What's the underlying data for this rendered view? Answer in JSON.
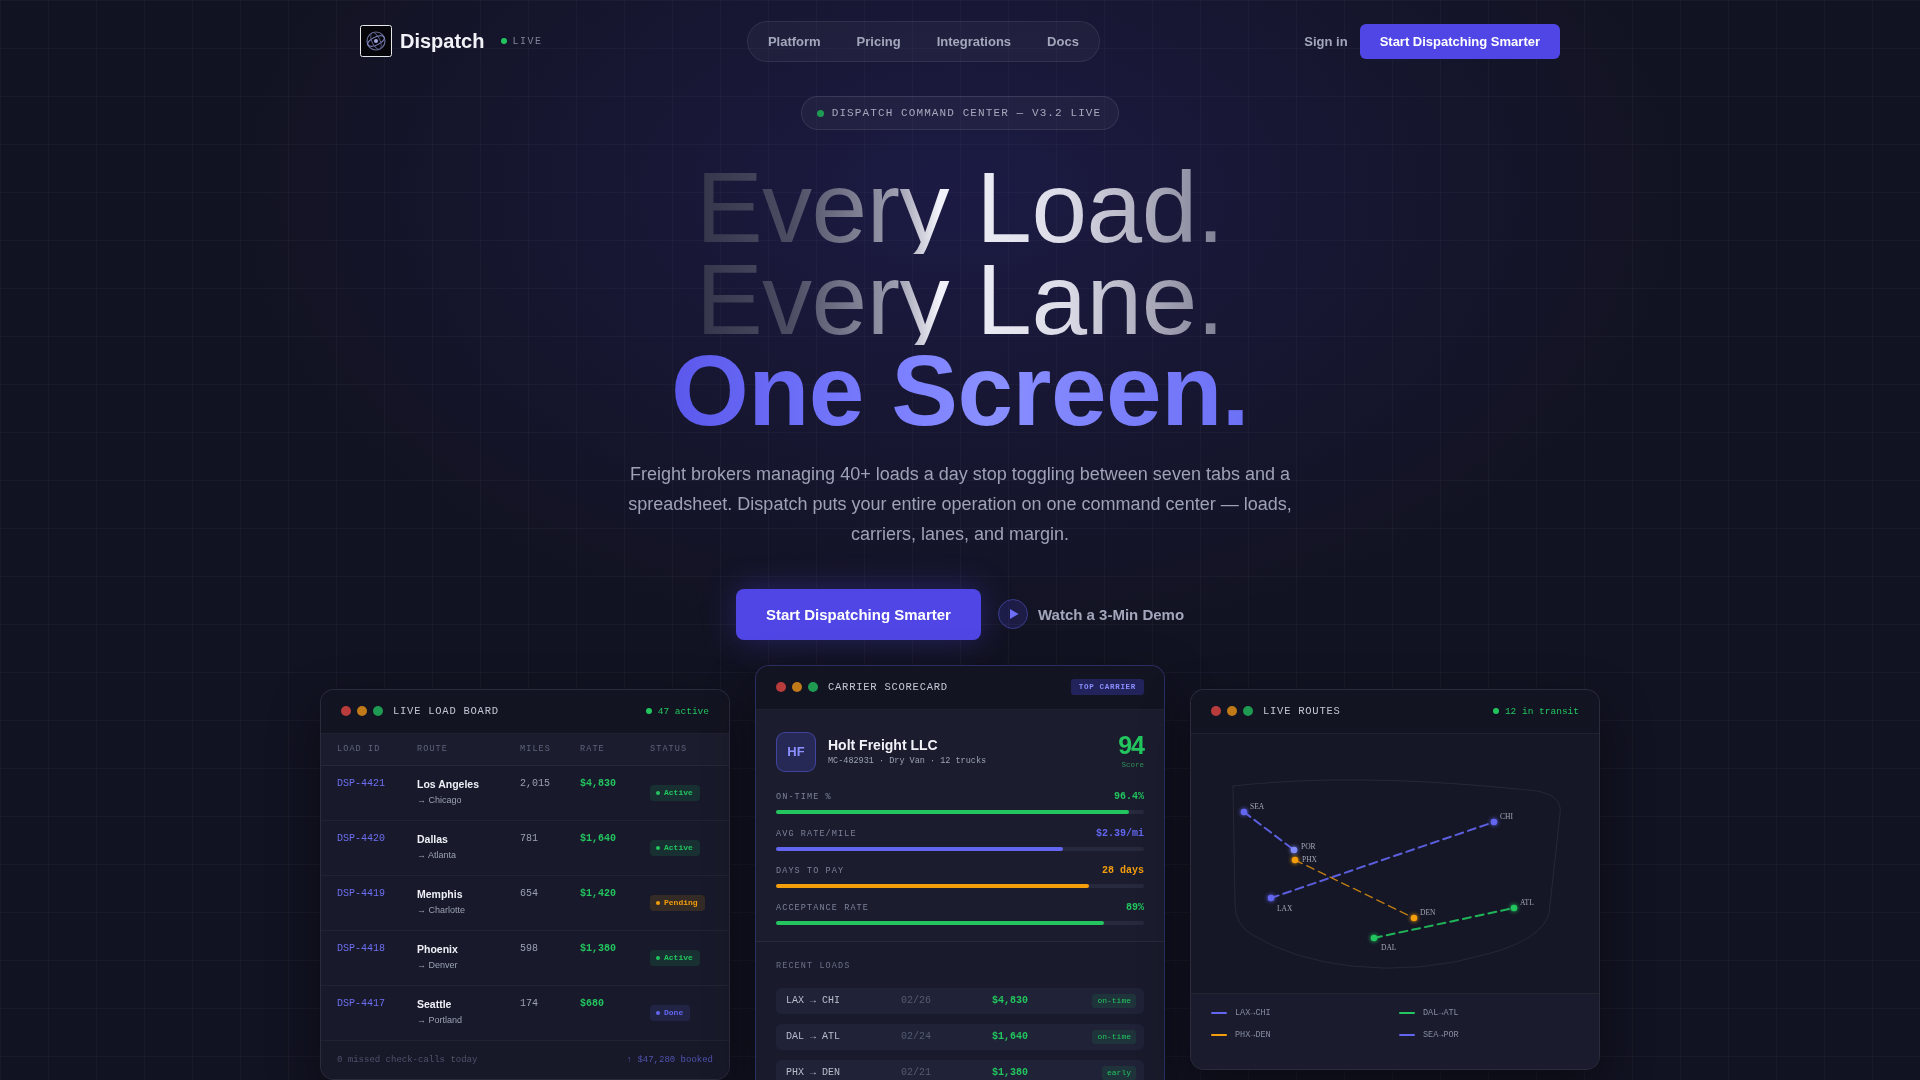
{
  "nav": {
    "brand": "Dispatch",
    "live_label": "LIVE",
    "links": [
      "Platform",
      "Pricing",
      "Integrations",
      "Docs"
    ],
    "sign_in": "Sign in",
    "cta": "Start Dispatching Smarter"
  },
  "hero": {
    "badge": "DISPATCH COMMAND CENTER — V3.2 LIVE",
    "headline": [
      {
        "text": "Every Load.",
        "kind": "muted"
      },
      {
        "text": "Every Lane.",
        "kind": "muted"
      },
      {
        "text": "One Screen.",
        "kind": "accent"
      }
    ],
    "subtitle": "Freight brokers managing 40+ loads a day stop toggling between seven tabs and a spreadsheet. Dispatch puts your entire operation on one command center — loads, carriers, lanes, and margin.",
    "primary_cta": "Start Dispatching Smarter",
    "demo": "Watch a 3-Min Demo"
  },
  "load_board": {
    "title": "LIVE LOAD BOARD",
    "status": "47 active",
    "columns": [
      "LOAD ID",
      "ROUTE",
      "MILES",
      "RATE",
      "STATUS"
    ],
    "rows": [
      {
        "id": "DSP-4421",
        "origin": "Los Angeles",
        "destination": "→ Chicago",
        "miles": "2,015",
        "rate": "$4,830",
        "status": "Active",
        "color": "#22c55e"
      },
      {
        "id": "DSP-4420",
        "origin": "Dallas",
        "destination": "→ Atlanta",
        "miles": "781",
        "rate": "$1,640",
        "status": "Active",
        "color": "#22c55e"
      },
      {
        "id": "DSP-4419",
        "origin": "Memphis",
        "destination": "→ Charlotte",
        "miles": "654",
        "rate": "$1,420",
        "status": "Pending",
        "color": "#f59e0b"
      },
      {
        "id": "DSP-4418",
        "origin": "Phoenix",
        "destination": "→ Denver",
        "miles": "598",
        "rate": "$1,380",
        "status": "Active",
        "color": "#22c55e"
      },
      {
        "id": "DSP-4417",
        "origin": "Seattle",
        "destination": "→ Portland",
        "miles": "174",
        "rate": "$680",
        "status": "Done",
        "color": "#6366f1"
      }
    ],
    "footer_note": "0 missed check-calls today",
    "footer_total": "↑ $47,280 booked"
  },
  "carrier": {
    "title": "CARRIER SCORECARD",
    "tag": "TOP CARRIER",
    "initials": "HF",
    "name": "Holt Freight LLC",
    "meta": "MC-482931 · Dry Van · 12 trucks",
    "score": "94",
    "score_label": "Score",
    "metrics": [
      {
        "label": "ON-TIME %",
        "value": "96.4%",
        "level": 0.96,
        "color": "#22c55e"
      },
      {
        "label": "AVG RATE/MILE",
        "value": "$2.39/mi",
        "level": 0.78,
        "color": "#6366f1"
      },
      {
        "label": "DAYS TO PAY",
        "value": "28 days",
        "level": 0.85,
        "color": "#f59e0b"
      },
      {
        "label": "ACCEPTANCE RATE",
        "value": "89%",
        "level": 0.89,
        "color": "#22c55e"
      }
    ],
    "recent_title": "RECENT LOADS",
    "recent": [
      {
        "route": "LAX → CHI",
        "date": "02/26",
        "amount": "$4,830",
        "tag": "on-time"
      },
      {
        "route": "DAL → ATL",
        "date": "02/24",
        "amount": "$1,640",
        "tag": "on-time"
      },
      {
        "route": "PHX → DEN",
        "date": "02/21",
        "amount": "$1,380",
        "tag": "early"
      }
    ]
  },
  "routes": {
    "title": "LIVE ROUTES",
    "status": "12 in transit",
    "cities": [
      {
        "label": "SEA",
        "color": "#6366f1"
      },
      {
        "label": "POR",
        "color": "#818cf8"
      },
      {
        "label": "PHX",
        "color": "#f59e0b"
      },
      {
        "label": "LAX",
        "color": "#6366f1"
      },
      {
        "label": "CHI",
        "color": "#6366f1"
      },
      {
        "label": "DEN",
        "color": "#f59e0b"
      },
      {
        "label": "DAL",
        "color": "#22c55e"
      },
      {
        "label": "ATL",
        "color": "#22c55e"
      }
    ],
    "legend": [
      {
        "label": "LAX→CHI",
        "color": "#6366f1"
      },
      {
        "label": "DAL→ATL",
        "color": "#22c55e"
      },
      {
        "label": "PHX→DEN",
        "color": "#f59e0b"
      },
      {
        "label": "SEA→POR",
        "color": "#6366f1"
      }
    ]
  }
}
